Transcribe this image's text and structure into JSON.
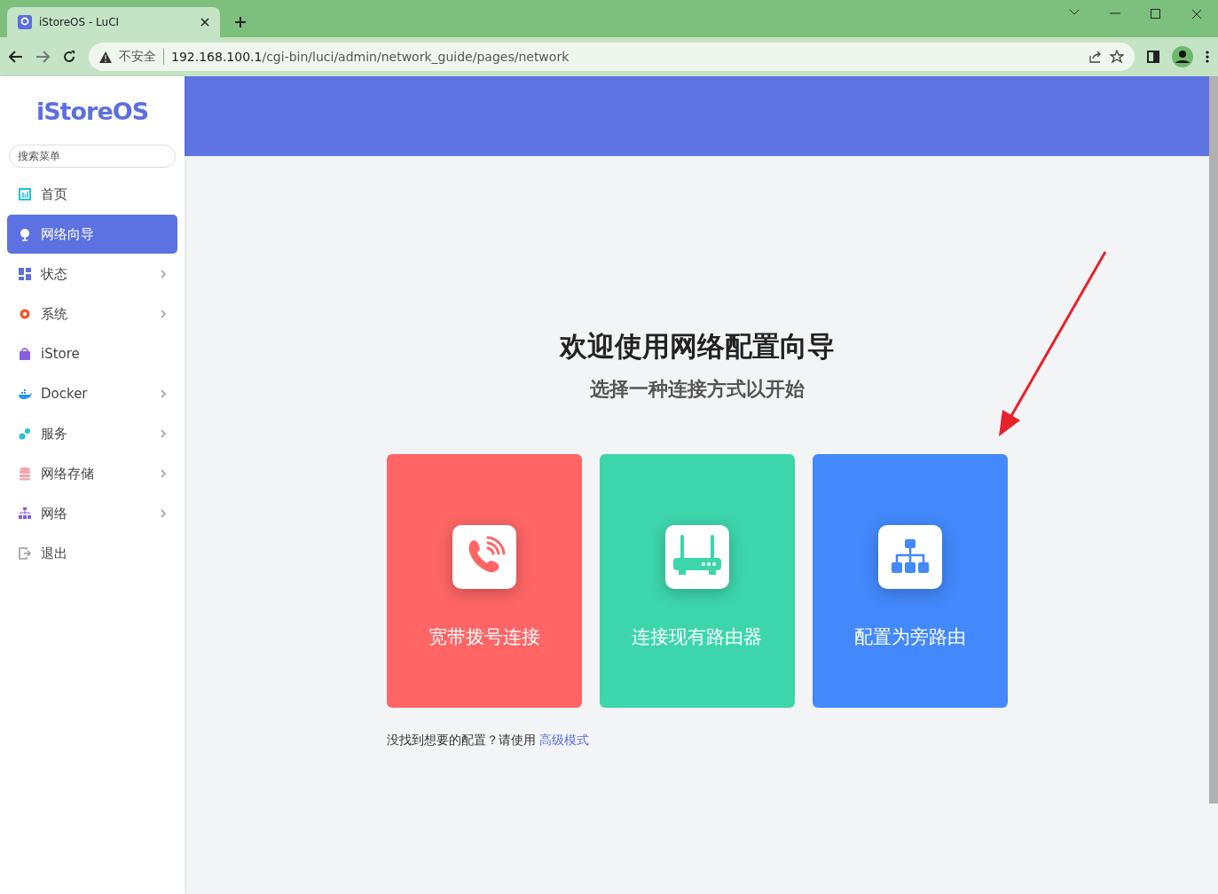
{
  "browser": {
    "tab_title": "iStoreOS - LuCI",
    "security": "不安全",
    "url_host": "192.168.100.1",
    "url_path": "/cgi-bin/luci/admin/network_guide/pages/network"
  },
  "sidebar": {
    "logo": "iStoreOS",
    "search_placeholder": "搜索菜单",
    "items": [
      {
        "label": "首页",
        "selected": false,
        "expandable": false
      },
      {
        "label": "网络向导",
        "selected": true,
        "expandable": false
      },
      {
        "label": "状态",
        "selected": false,
        "expandable": true
      },
      {
        "label": "系统",
        "selected": false,
        "expandable": true
      },
      {
        "label": "iStore",
        "selected": false,
        "expandable": false
      },
      {
        "label": "Docker",
        "selected": false,
        "expandable": true
      },
      {
        "label": "服务",
        "selected": false,
        "expandable": true
      },
      {
        "label": "网络存储",
        "selected": false,
        "expandable": true
      },
      {
        "label": "网络",
        "selected": false,
        "expandable": true
      },
      {
        "label": "退出",
        "selected": false,
        "expandable": false
      }
    ]
  },
  "main": {
    "title": "欢迎使用网络配置向导",
    "subtitle": "选择一种连接方式以开始",
    "cards": [
      {
        "label": "宽带拨号连接",
        "color": "#ff6565"
      },
      {
        "label": "连接现有路由器",
        "color": "#3dd6ab"
      },
      {
        "label": "配置为旁路由",
        "color": "#4389fc"
      }
    ],
    "footer_text": "没找到想要的配置？请使用",
    "footer_link": "高级模式"
  }
}
